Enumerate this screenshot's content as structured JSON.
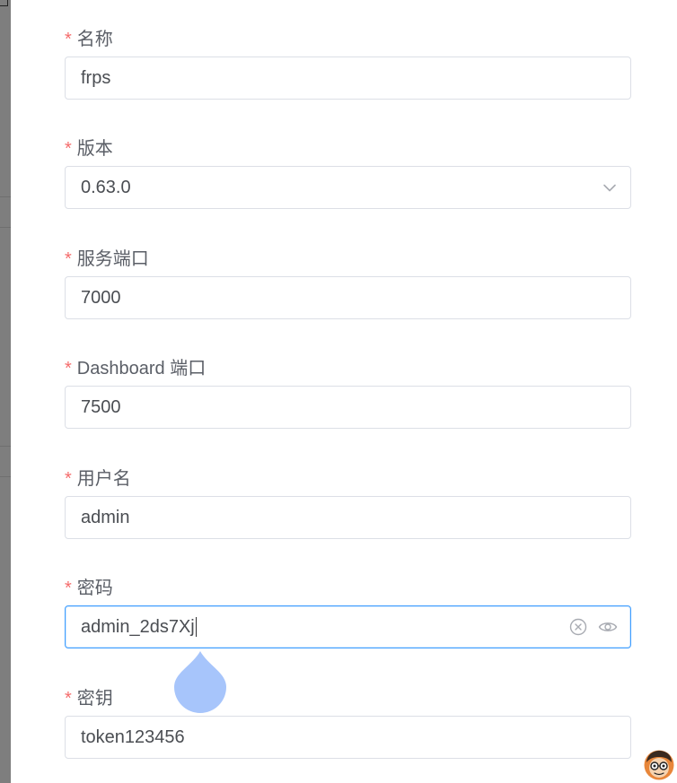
{
  "form": {
    "required_mark": "*",
    "name": {
      "label": "名称",
      "value": "frps"
    },
    "version": {
      "label": "版本",
      "value": "0.63.0"
    },
    "service_port": {
      "label": "服务端口",
      "value": "7000"
    },
    "dashboard_port": {
      "label": "Dashboard 端口",
      "value": "7500"
    },
    "username": {
      "label": "用户名",
      "value": "admin"
    },
    "password": {
      "label": "密码",
      "value": "admin_2ds7Xj"
    },
    "secret_key": {
      "label": "密钥",
      "value": "token123456"
    }
  },
  "colors": {
    "required": "#f56c6c",
    "focus_border": "#409eff",
    "border": "#dcdfe6",
    "backdrop": "#7e7e7e",
    "touch_drop": "#a7c5fb"
  },
  "icons": {
    "version_select": "chevron-down-icon",
    "password_clear": "circle-close-icon",
    "password_toggle": "eye-icon"
  }
}
